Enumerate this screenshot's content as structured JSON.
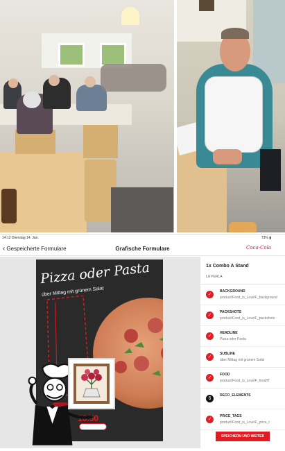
{
  "status_bar": {
    "time": "14:12",
    "date": "Dienstag 14. Jan.",
    "battery": "73%"
  },
  "nav": {
    "back_label": "Gespeicherte Formulare",
    "title": "Grafische Formulare",
    "brand": "Coca-Cola"
  },
  "poster": {
    "headline": "Pizza oder Pasta",
    "subline": "über Mittag mit grünem Salat",
    "menu_label": "MENU",
    "price": "16.50"
  },
  "side_panel": {
    "title": "1x Combo A Stand",
    "subtitle": "LA PERLA",
    "save_label": "SPEICHERN UND WEITER",
    "items": [
      {
        "title": "BACKGROUND",
        "value": "product/Food_is_Love/F_background",
        "status": "check"
      },
      {
        "title": "PACKSHOTS",
        "value": "product/Food_is_Love/F_packshots",
        "status": "check"
      },
      {
        "title": "HEADLINE",
        "value": "Pizza oder Pasta",
        "status": "check"
      },
      {
        "title": "SUBLINE",
        "value": "über Mittag mit grünem Salat",
        "status": "check"
      },
      {
        "title": "FOOD",
        "value": "product/Food_is_Love/F_food/IT",
        "status": "check"
      },
      {
        "title": "DECO_ELEMENTS",
        "value": "",
        "status": "6"
      },
      {
        "title": "PRICE_TAGS",
        "value": "product/Food_is_Love/F_price_t",
        "status": "check"
      }
    ]
  },
  "icons": {
    "check": "check-icon",
    "back": "chevron-left-icon"
  },
  "colors": {
    "accent": "#e31b23",
    "brand_red": "#d1102b"
  }
}
